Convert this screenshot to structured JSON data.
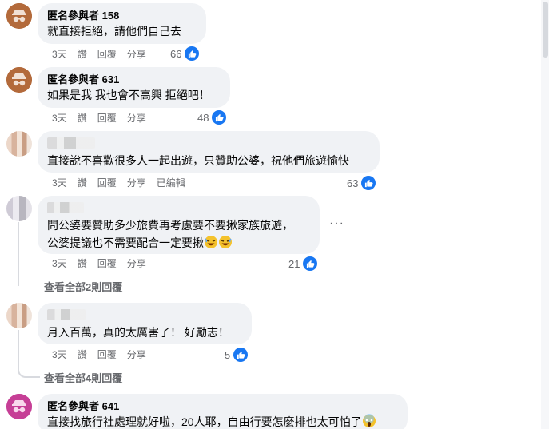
{
  "comments": [
    {
      "name": "匿名參與者 158",
      "text": "就直接拒絕，請他們自己去",
      "time": "3天",
      "read": "讚",
      "reply": "回覆",
      "share": "分享",
      "edited": "",
      "likes": "66"
    },
    {
      "name": "匿名參與者 631",
      "text": "如果是我 我也會不高興 拒絕吧！",
      "time": "3天",
      "read": "讚",
      "reply": "回覆",
      "share": "分享",
      "edited": "",
      "likes": "48"
    },
    {
      "name": "",
      "text": "直接說不喜歡很多人一起出遊，只贊助公婆，祝他們旅遊愉快",
      "time": "3天",
      "read": "讚",
      "reply": "回覆",
      "share": "分享",
      "edited": "已編輯",
      "likes": "63"
    },
    {
      "name": "",
      "text_line1": "問公婆要贊助多少旅費再考慮要不要揪家族旅遊，",
      "text_line2": "公婆提議也不需要配合一定要揪",
      "time": "3天",
      "read": "讚",
      "reply": "回覆",
      "share": "分享",
      "edited": "",
      "likes": "21",
      "view_replies": "查看全部2則回覆"
    },
    {
      "name": "",
      "text": "月入百萬，真的太厲害了！ 好勵志！",
      "time": "3天",
      "read": "讚",
      "reply": "回覆",
      "share": "分享",
      "edited": "",
      "likes": "5",
      "view_replies": "查看全部4則回覆"
    },
    {
      "name": "匿名參與者 641",
      "text": "直接找旅行社處理就好啦，20人耶，自由行要怎麼排也太可怕了",
      "time": "",
      "read": "",
      "reply": "",
      "share": "",
      "edited": "",
      "likes": ""
    }
  ],
  "icons": {
    "like": "thumbs-up-icon",
    "more": "more-options-icon",
    "anonymous": "anonymous-avatar-icon",
    "emoji_laugh": "rolling-laughing-emoji",
    "emoji_scream": "scream-emoji"
  },
  "colors": {
    "bubble": "#f0f2f5",
    "text": "#050505",
    "meta": "#65676b",
    "like_blue": "#1877f2",
    "anon_brown": "#b36a3b",
    "anon_pink": "#c63f96"
  }
}
